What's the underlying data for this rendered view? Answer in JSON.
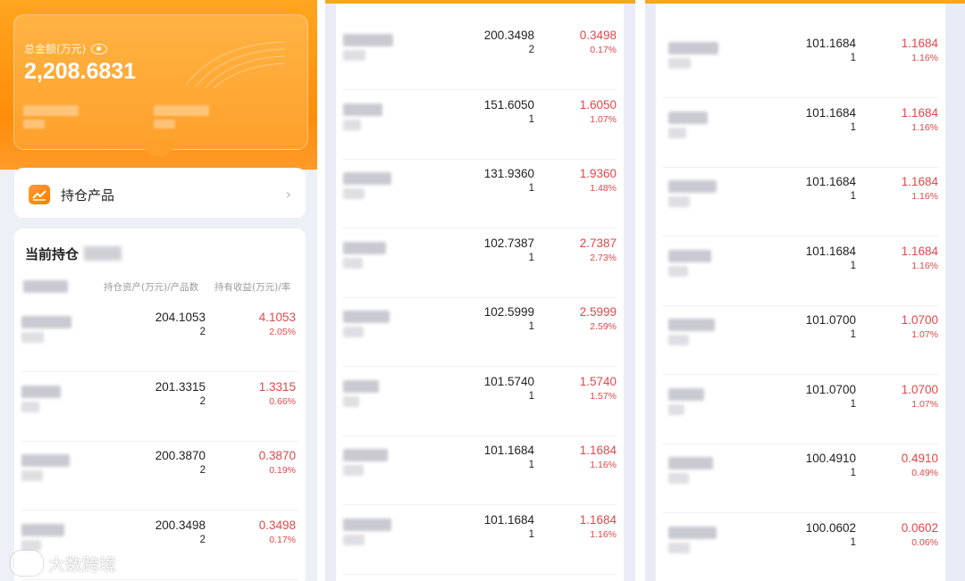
{
  "panel1": {
    "total_label": "总金额(万元)",
    "total_value": "2,208.6831",
    "holdings_title": "持仓产品",
    "list_title": "当前持仓",
    "col_assets": "持仓资产(万元)/产品数",
    "col_profit": "持有收益(万元)/率",
    "rows": [
      {
        "amount": "204.1053",
        "count": "2",
        "profit": "4.1053",
        "rate": "2.05%"
      },
      {
        "amount": "201.3315",
        "count": "2",
        "profit": "1.3315",
        "rate": "0.66%"
      },
      {
        "amount": "200.3870",
        "count": "2",
        "profit": "0.3870",
        "rate": "0.19%"
      },
      {
        "amount": "200.3498",
        "count": "2",
        "profit": "0.3498",
        "rate": "0.17%"
      }
    ]
  },
  "panel2": {
    "rows": [
      {
        "amount": "200.3498",
        "count": "2",
        "profit": "0.3498",
        "rate": "0.17%"
      },
      {
        "amount": "151.6050",
        "count": "1",
        "profit": "1.6050",
        "rate": "1.07%"
      },
      {
        "amount": "131.9360",
        "count": "1",
        "profit": "1.9360",
        "rate": "1.48%"
      },
      {
        "amount": "102.7387",
        "count": "1",
        "profit": "2.7387",
        "rate": "2.73%"
      },
      {
        "amount": "102.5999",
        "count": "1",
        "profit": "2.5999",
        "rate": "2.59%"
      },
      {
        "amount": "101.5740",
        "count": "1",
        "profit": "1.5740",
        "rate": "1.57%"
      },
      {
        "amount": "101.1684",
        "count": "1",
        "profit": "1.1684",
        "rate": "1.16%"
      },
      {
        "amount": "101.1684",
        "count": "1",
        "profit": "1.1684",
        "rate": "1.16%"
      }
    ]
  },
  "panel3": {
    "rows": [
      {
        "amount": "101.1684",
        "count": "1",
        "profit": "1.1684",
        "rate": "1.16%"
      },
      {
        "amount": "101.1684",
        "count": "1",
        "profit": "1.1684",
        "rate": "1.16%"
      },
      {
        "amount": "101.1684",
        "count": "1",
        "profit": "1.1684",
        "rate": "1.16%"
      },
      {
        "amount": "101.1684",
        "count": "1",
        "profit": "1.1684",
        "rate": "1.16%"
      },
      {
        "amount": "101.0700",
        "count": "1",
        "profit": "1.0700",
        "rate": "1.07%"
      },
      {
        "amount": "101.0700",
        "count": "1",
        "profit": "1.0700",
        "rate": "1.07%"
      },
      {
        "amount": "100.4910",
        "count": "1",
        "profit": "0.4910",
        "rate": "0.49%"
      },
      {
        "amount": "100.0602",
        "count": "1",
        "profit": "0.0602",
        "rate": "0.06%"
      }
    ]
  },
  "watermark": {
    "text": "大数跨境"
  },
  "colors": {
    "accent": "#ff9a1f",
    "profit_red": "#e1484a",
    "bg": "#eef0f8"
  },
  "icons": {
    "eye": "eye-icon",
    "chevron": "chevron-right-icon",
    "holdings": "chart-up-icon"
  }
}
